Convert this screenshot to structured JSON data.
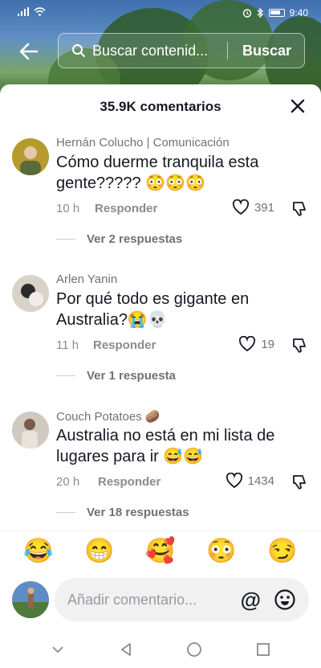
{
  "status": {
    "time": "9:40"
  },
  "header": {
    "search_placeholder": "Buscar contenid...",
    "search_button": "Buscar"
  },
  "sheet": {
    "title": "35.9K comentarios"
  },
  "comments": [
    {
      "user": "Hernán Colucho | Comunicación",
      "text": "Cómo duerme tranquila esta gente????? 😳😳😳",
      "time": "10 h",
      "reply_label": "Responder",
      "likes": "391",
      "more": "Ver 2 respuestas"
    },
    {
      "user": "Arlen Yanin",
      "text": "Por qué todo es gigante en Australia?😭💀",
      "time": "11 h",
      "reply_label": "Responder",
      "likes": "19",
      "more": "Ver 1 respuesta"
    },
    {
      "user": "Couch Potatoes 🥔",
      "text": "Australia no está en mi lista de lugares para ir 😅😅",
      "time": "20 h",
      "reply_label": "Responder",
      "likes": "1434",
      "more": "Ver 18 respuestas"
    }
  ],
  "emoji_bar": [
    "😂",
    "😁",
    "🥰",
    "😳",
    "😏"
  ],
  "composer": {
    "placeholder": "Añadir comentario...",
    "at_symbol": "@"
  }
}
